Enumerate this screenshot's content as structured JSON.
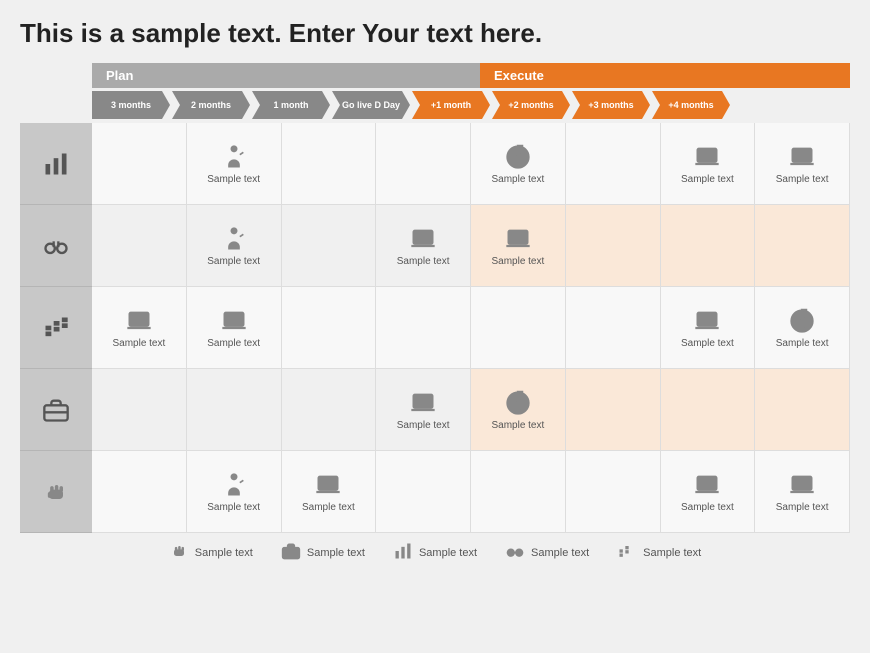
{
  "title": "This is a sample text. Enter Your text here.",
  "phases": {
    "plan": {
      "label": "Plan"
    },
    "execute": {
      "label": "Execute"
    }
  },
  "timeline": [
    {
      "label": "3 months",
      "type": "gray"
    },
    {
      "label": "2 months",
      "type": "gray"
    },
    {
      "label": "1 month",
      "type": "gray"
    },
    {
      "label": "Go live D Day",
      "type": "gray"
    },
    {
      "label": "+1 month",
      "type": "orange"
    },
    {
      "label": "+2 months",
      "type": "orange"
    },
    {
      "label": "+3 months",
      "type": "orange"
    },
    {
      "label": "+4 months",
      "type": "orange"
    }
  ],
  "rows": [
    {
      "cells": [
        {
          "empty": true
        },
        {
          "icon": "person",
          "text": "Sample text"
        },
        {
          "empty": true
        },
        {
          "empty": true
        },
        {
          "icon": "target",
          "text": "Sample text",
          "execute": true
        },
        {
          "empty": true,
          "execute": true
        },
        {
          "icon": "laptop",
          "text": "Sample text",
          "execute": true
        },
        {
          "icon": "laptop",
          "text": "Sample text",
          "execute": true
        }
      ]
    },
    {
      "cells": [
        {
          "empty": true
        },
        {
          "icon": "person",
          "text": "Sample text"
        },
        {
          "empty": true
        },
        {
          "icon": "laptop",
          "text": "Sample text"
        },
        {
          "icon": "laptop",
          "text": "Sample text",
          "execute": true
        },
        {
          "empty": true,
          "execute": true
        },
        {
          "empty": true,
          "execute": true
        },
        {
          "empty": true,
          "execute": true
        }
      ]
    },
    {
      "cells": [
        {
          "icon": "laptop",
          "text": "Sample text"
        },
        {
          "icon": "laptop",
          "text": "Sample text"
        },
        {
          "empty": true
        },
        {
          "empty": true
        },
        {
          "empty": true,
          "execute": true
        },
        {
          "empty": true,
          "execute": true
        },
        {
          "icon": "laptop",
          "text": "Sample text",
          "execute": true
        },
        {
          "icon": "target",
          "text": "Sample text",
          "execute": true
        }
      ]
    },
    {
      "cells": [
        {
          "empty": true
        },
        {
          "empty": true
        },
        {
          "empty": true
        },
        {
          "icon": "laptop",
          "text": "Sample text"
        },
        {
          "icon": "target",
          "text": "Sample text",
          "execute": true
        },
        {
          "empty": true,
          "execute": true
        },
        {
          "empty": true,
          "execute": true
        },
        {
          "empty": true,
          "execute": true
        }
      ]
    },
    {
      "cells": [
        {
          "empty": true
        },
        {
          "icon": "person",
          "text": "Sample text"
        },
        {
          "icon": "laptop",
          "text": "Sample text"
        },
        {
          "empty": true
        },
        {
          "empty": true,
          "execute": true
        },
        {
          "empty": true,
          "execute": true
        },
        {
          "icon": "laptop",
          "text": "Sample text",
          "execute": true
        },
        {
          "icon": "laptop",
          "text": "Sample text",
          "execute": true
        }
      ]
    }
  ],
  "legend": [
    {
      "icon": "fist",
      "text": "Sample text"
    },
    {
      "icon": "briefcase",
      "text": "Sample text"
    },
    {
      "icon": "barchart",
      "text": "Sample text"
    },
    {
      "icon": "binoculars",
      "text": "Sample text"
    },
    {
      "icon": "chart",
      "text": "Sample text"
    }
  ]
}
